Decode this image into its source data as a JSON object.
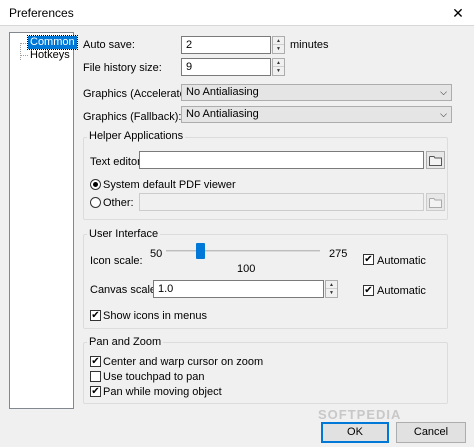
{
  "window": {
    "title": "Preferences",
    "close_glyph": "✕"
  },
  "tree": {
    "items": [
      {
        "label": "Common",
        "selected": true
      },
      {
        "label": "Hotkeys",
        "selected": false
      }
    ]
  },
  "auto_save": {
    "label": "Auto save:",
    "value": "2",
    "unit": "minutes"
  },
  "file_history": {
    "label": "File history size:",
    "value": "9"
  },
  "graphics_accel": {
    "label": "Graphics (Accelerated):",
    "value": "No Antialiasing"
  },
  "graphics_fallback": {
    "label": "Graphics (Fallback):",
    "value": "No Antialiasing"
  },
  "helper": {
    "title": "Helper Applications",
    "text_editor_label": "Text editor:",
    "text_editor_value": "",
    "pdf_default_label": "System default PDF viewer",
    "pdf_default_selected": true,
    "pdf_other_label": "Other:",
    "pdf_other_value": ""
  },
  "ui": {
    "title": "User Interface",
    "icon_scale_label": "Icon scale:",
    "icon_scale_min": "50",
    "icon_scale_max": "275",
    "icon_scale_value": "100",
    "icon_scale_fraction": 0.222,
    "icon_auto_label": "Automatic",
    "icon_auto_checked": true,
    "canvas_scale_label": "Canvas scale:",
    "canvas_scale_value": "1.0",
    "canvas_auto_label": "Automatic",
    "canvas_auto_checked": true,
    "show_icons_label": "Show icons in menus",
    "show_icons_checked": true
  },
  "pan": {
    "title": "Pan and Zoom",
    "center_warp_label": "Center and warp cursor on zoom",
    "center_warp_checked": true,
    "touchpad_label": "Use touchpad to pan",
    "touchpad_checked": false,
    "pan_moving_label": "Pan while moving object",
    "pan_moving_checked": true
  },
  "buttons": {
    "ok": "OK",
    "cancel": "Cancel"
  },
  "watermark": "SOFTPEDIA",
  "icons": {
    "check": "✔",
    "combo_arrow": "⌵",
    "spin_up": "▲",
    "spin_down": "▼"
  }
}
